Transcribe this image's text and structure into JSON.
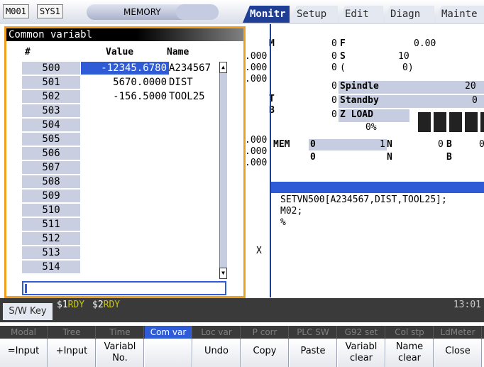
{
  "top": {
    "machine": "M001",
    "system": "SYS1",
    "mode": "MEMORY",
    "tabs": [
      "Monitr",
      "Setup",
      "Edit",
      "Diagn",
      "Mainte"
    ]
  },
  "dialog": {
    "title": "Common variabl",
    "headers": {
      "num": "#",
      "value": "Value",
      "name": "Name"
    },
    "rows": [
      {
        "num": "500",
        "value": "-12345.6780",
        "name": "A234567"
      },
      {
        "num": "501",
        "value": "5670.0000",
        "name": "DIST"
      },
      {
        "num": "502",
        "value": "-156.5000",
        "name": "TOOL25"
      },
      {
        "num": "503",
        "value": "",
        "name": ""
      },
      {
        "num": "504",
        "value": "",
        "name": ""
      },
      {
        "num": "505",
        "value": "",
        "name": ""
      },
      {
        "num": "506",
        "value": "",
        "name": ""
      },
      {
        "num": "507",
        "value": "",
        "name": ""
      },
      {
        "num": "508",
        "value": "",
        "name": ""
      },
      {
        "num": "509",
        "value": "",
        "name": ""
      },
      {
        "num": "510",
        "value": "",
        "name": ""
      },
      {
        "num": "511",
        "value": "",
        "name": ""
      },
      {
        "num": "512",
        "value": "",
        "name": ""
      },
      {
        "num": "513",
        "value": "",
        "name": ""
      },
      {
        "num": "514",
        "value": "",
        "name": ""
      }
    ],
    "scroll_up": "▲",
    "scroll_down": "▼",
    "input_value": ""
  },
  "monitor": {
    "m_label": "M",
    "s_label": "S",
    "t_label": "T",
    "b_label": "B",
    "axis_vals": [
      ".000",
      ".000",
      ".000",
      ".000",
      ".000",
      ".000"
    ],
    "zeros": [
      "0",
      "0",
      "0",
      "0",
      "0",
      "0"
    ],
    "f_label": "F",
    "f_value": "0.00",
    "s_value": "10",
    "paren_open": "(",
    "paren_value": "0)",
    "spindle_label": "Spindle",
    "spindle_value": "20",
    "standby_label": "Standby",
    "standby_value": "0",
    "zload_label": "Z LOAD",
    "zload_pct": "0%",
    "mem_label": "MEM",
    "mem_o1": "0",
    "mem_o2": "0",
    "mem_1": "1",
    "n_label": "N",
    "n_label2": "N",
    "zero_b": "0",
    "b_label2": "B",
    "b_label3": "B",
    "zero_c": "0",
    "program_lines": [
      "SETVN500[A234567,DIST,TOOL25];",
      "M02;",
      "%"
    ],
    "x_label": "X"
  },
  "status": {
    "swkey": "S/W Key",
    "sys1": "$1",
    "rdy1": "RDY",
    "sys2": "$2",
    "rdy2": "RDY",
    "clock": "13:01"
  },
  "menu_top": [
    "Modal",
    "Tree",
    "Time",
    "Com var",
    "Loc var",
    "P corr",
    "PLC SW",
    "G92 set",
    "Col stp",
    "LdMeter"
  ],
  "menu_bottom": [
    {
      "l1": "=Input",
      "l2": ""
    },
    {
      "l1": "+Input",
      "l2": ""
    },
    {
      "l1": "Variabl",
      "l2": "No."
    },
    {
      "l1": "",
      "l2": ""
    },
    {
      "l1": "Undo",
      "l2": ""
    },
    {
      "l1": "Copy",
      "l2": ""
    },
    {
      "l1": "Paste",
      "l2": ""
    },
    {
      "l1": "Variabl",
      "l2": "clear"
    },
    {
      "l1": "Name",
      "l2": "clear"
    },
    {
      "l1": "Close",
      "l2": ""
    }
  ],
  "colors": {
    "accent": "#2f5cd6",
    "dialog_border": "#f0a020",
    "tab_active": "#1f3f96",
    "rdy": "#c8c800"
  }
}
